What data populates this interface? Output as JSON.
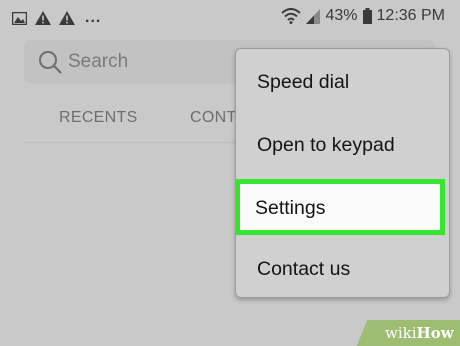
{
  "status_bar": {
    "battery": "43%",
    "time": "12:36 PM",
    "overflow": "...",
    "icons": [
      "image-icon",
      "warning-icon",
      "warning-icon",
      "wifi-icon",
      "signal-icon",
      "battery-icon"
    ]
  },
  "search": {
    "placeholder": "Search"
  },
  "tabs": [
    {
      "label": "RECENTS"
    },
    {
      "label": "CONTACTS"
    }
  ],
  "menu": {
    "items": [
      {
        "label": "Speed dial"
      },
      {
        "label": "Open to keypad"
      },
      {
        "label": "Settings",
        "highlighted": true
      },
      {
        "label": "Contact us"
      }
    ]
  },
  "watermark": {
    "wiki": "wiki",
    "how": "How"
  },
  "colors": {
    "highlight": "#37e432",
    "watermark_bg": "#9cbd72"
  }
}
